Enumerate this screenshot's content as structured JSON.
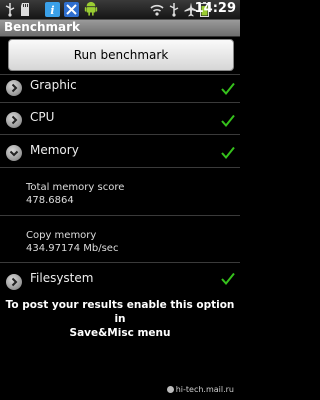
{
  "status_bar": {
    "time": "14:29",
    "left_icons": [
      "usb-icon",
      "sd-card-icon",
      "info-icon",
      "tools-icon",
      "android-icon"
    ],
    "right_icons": [
      "wifi-icon",
      "usb-connection-icon",
      "airplane-icon",
      "battery-icon"
    ]
  },
  "app": {
    "title": "Benchmark"
  },
  "run_button": {
    "label": "Run benchmark"
  },
  "sections": [
    {
      "label": "Graphic",
      "state": "collapsed",
      "checked": true
    },
    {
      "label": "CPU",
      "state": "collapsed",
      "checked": true
    },
    {
      "label": "Memory",
      "state": "expanded",
      "checked": true
    },
    {
      "label": "Filesystem",
      "state": "collapsed",
      "checked": true
    }
  ],
  "memory_details": [
    {
      "label": "Total memory score",
      "value": "478.6864"
    },
    {
      "label": "Copy memory",
      "value": "434.97174 Mb/sec"
    }
  ],
  "notice": {
    "line1": "To post your results enable this option in",
    "line2": "Save&Misc menu"
  },
  "watermark": {
    "text": "hi-tech.mail.ru"
  },
  "colors": {
    "check_green": "#36c21c",
    "title_bar": "#808080",
    "background": "#000000"
  }
}
